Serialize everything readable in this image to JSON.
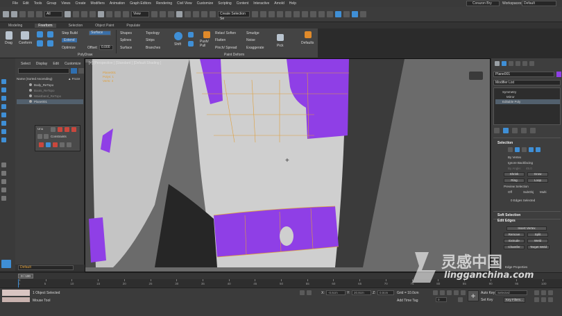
{
  "menubar": {
    "items": [
      "File",
      "Edit",
      "Tools",
      "Group",
      "Views",
      "Create",
      "Modifiers",
      "Animation",
      "Graph Editors",
      "Rendering",
      "Civil View",
      "Customize",
      "Scripting",
      "Content",
      "Interactive",
      "Arnold",
      "Help"
    ],
    "user": "Corazon Bry",
    "workspaces_label": "Workspaces:",
    "workspace": "Default"
  },
  "toolbar": {
    "filter": "All",
    "coord": "View",
    "selection_set": "Create Selection Se"
  },
  "ribbon_tabs": [
    "Modeling",
    "Freeform",
    "Selection",
    "Object Paint",
    "Populate"
  ],
  "ribbon": {
    "drag": "Drag",
    "conform": "Conform",
    "step_build": "Step Build",
    "extend": "Extend",
    "optimize": "Optimize",
    "surface": "Surface",
    "offset_label": "Offset:",
    "offset_value": "0.000",
    "shapes": "Shapes",
    "splines": "Splines",
    "surface2": "Surface",
    "topology": "Topology",
    "strips": "Strips",
    "branches": "Branches",
    "shift": "Shift",
    "push_pull": "Push/ Pull",
    "relax_soften": "Relax/ Soften",
    "flatten": "Flatten",
    "pinch_spread": "Pinch/ Spread",
    "smudge": "Smudge",
    "noise": "Noise",
    "exaggerate": "Exaggerate",
    "pick": "Pick",
    "defaults": "Defaults",
    "group_polydraw": "PolyDraw",
    "group_paint_deform": "Paint Deform"
  },
  "scene_explorer": {
    "menu": [
      "Select",
      "Display",
      "Edit",
      "Customize"
    ],
    "header": "Name (Sorted Ascending)",
    "header_col": "▲ Froze",
    "rows": [
      {
        "name": "Body_ReTopo"
      },
      {
        "name": "Boots_ReTopo"
      },
      {
        "name": "Waistband_ReTopo"
      },
      {
        "name": "Plane001"
      }
    ]
  },
  "float_toolbar": {
    "title": "Unu",
    "constraints": "Constraints"
  },
  "layer": "Default",
  "viewport": {
    "label": "[+] [Perspective ] [Standard ] [Default Shading ]",
    "stats_a": "Plane001",
    "stats_b": "Polys: 1",
    "stats_c": "Verts: 4"
  },
  "command_panel": {
    "object_name": "Plane001",
    "modifier_list": "Modifier List",
    "stack": [
      "Symmetry",
      "Mirror",
      "Editable Poly"
    ],
    "selection_title": "Selection",
    "by_vertex": "By Vertex",
    "ignore_backfacing": "Ignore Backfacing",
    "by_angle": "By Angle:",
    "by_angle_value": "45.0",
    "shrink": "Shrink",
    "grow": "Grow",
    "ring": "Ring",
    "loop": "Loop",
    "preview_selection": "Preview Selection",
    "off": "Off",
    "subobj": "SubObj",
    "multi": "Multi",
    "edges_selected": "0 Edges Selected",
    "soft_selection": "Soft Selection",
    "edit_edges": "Edit Edges",
    "insert_vertex": "Insert Vertex",
    "remove": "Remove",
    "split": "Split",
    "extrude": "Extrude",
    "weld": "Weld",
    "chamfer": "Chamfer",
    "target_weld": "Target Weld",
    "edit_properties": "Edge Properties"
  },
  "timeline": {
    "current": "0 / 100",
    "ticks": [
      "0",
      "5",
      "10",
      "15",
      "20",
      "25",
      "30",
      "35",
      "40",
      "45",
      "50",
      "55",
      "60",
      "65",
      "70",
      "75",
      "80",
      "85",
      "90",
      "95",
      "100"
    ]
  },
  "status": {
    "selected": "1 Object Selected",
    "hint": "Mouse Tool",
    "x_label": "X:",
    "x_value": "-0.6cm",
    "y_label": "Y:",
    "y_value": "20.8cm",
    "z_label": "Z:",
    "z_value": "0.0cm",
    "grid": "Grid = 10.0cm",
    "add_time_tag": "Add Time Tag",
    "auto_key": "Auto Key",
    "set_key": "Set Key",
    "selected_mode": "Selected",
    "key_filters": "Key Filters...",
    "frame": "0"
  },
  "watermark": {
    "brand": "灵感中国",
    "url": "lingganchina.com"
  },
  "colors": {
    "accent": "#3f8fd6",
    "paint_purple": "#8f3fe6",
    "mesh_gray": "#d0d0d0",
    "edge_orange": "#e0a03c"
  }
}
